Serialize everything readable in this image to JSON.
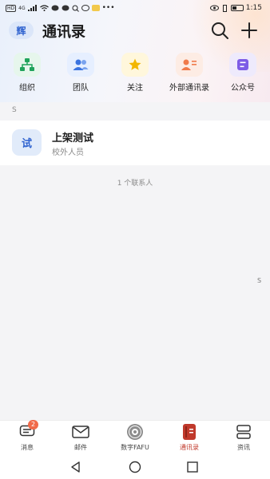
{
  "status_bar": {
    "left_badges": [
      "HD",
      "4G"
    ],
    "time": "1:15",
    "battery_text": ""
  },
  "header": {
    "avatar_char": "辉",
    "title": "通讯录"
  },
  "shortcuts": [
    {
      "label": "组织",
      "icon": "org-chart-icon",
      "bg": "#e6f6ec",
      "color": "#1fa35b"
    },
    {
      "label": "团队",
      "icon": "team-icon",
      "bg": "#e6efff",
      "color": "#3b74e0"
    },
    {
      "label": "关注",
      "icon": "star-icon",
      "bg": "#fff7dc",
      "color": "#f2b600"
    },
    {
      "label": "外部通讯录",
      "icon": "external-contacts-icon",
      "bg": "#fdece4",
      "color": "#f07a4a"
    },
    {
      "label": "公众号",
      "icon": "official-account-icon",
      "bg": "#eeeafc",
      "color": "#7d5ce6"
    }
  ],
  "section": {
    "letter": "S"
  },
  "contacts": [
    {
      "avatar_char": "试",
      "name": "上架测试",
      "subtitle": "校外人员"
    }
  ],
  "contact_count": "1 个联系人",
  "index_bar": {
    "letter": "S"
  },
  "tabbar": {
    "items": [
      {
        "label": "消息",
        "icon": "message-icon",
        "badge": "2",
        "active": false
      },
      {
        "label": "邮件",
        "icon": "mail-icon",
        "active": false
      },
      {
        "label": "数字FAFU",
        "icon": "fafu-logo-icon",
        "active": false
      },
      {
        "label": "通讯录",
        "icon": "contacts-book-icon",
        "active": true
      },
      {
        "label": "资讯",
        "icon": "news-icon",
        "active": false
      }
    ],
    "accent": "#c0392b"
  }
}
